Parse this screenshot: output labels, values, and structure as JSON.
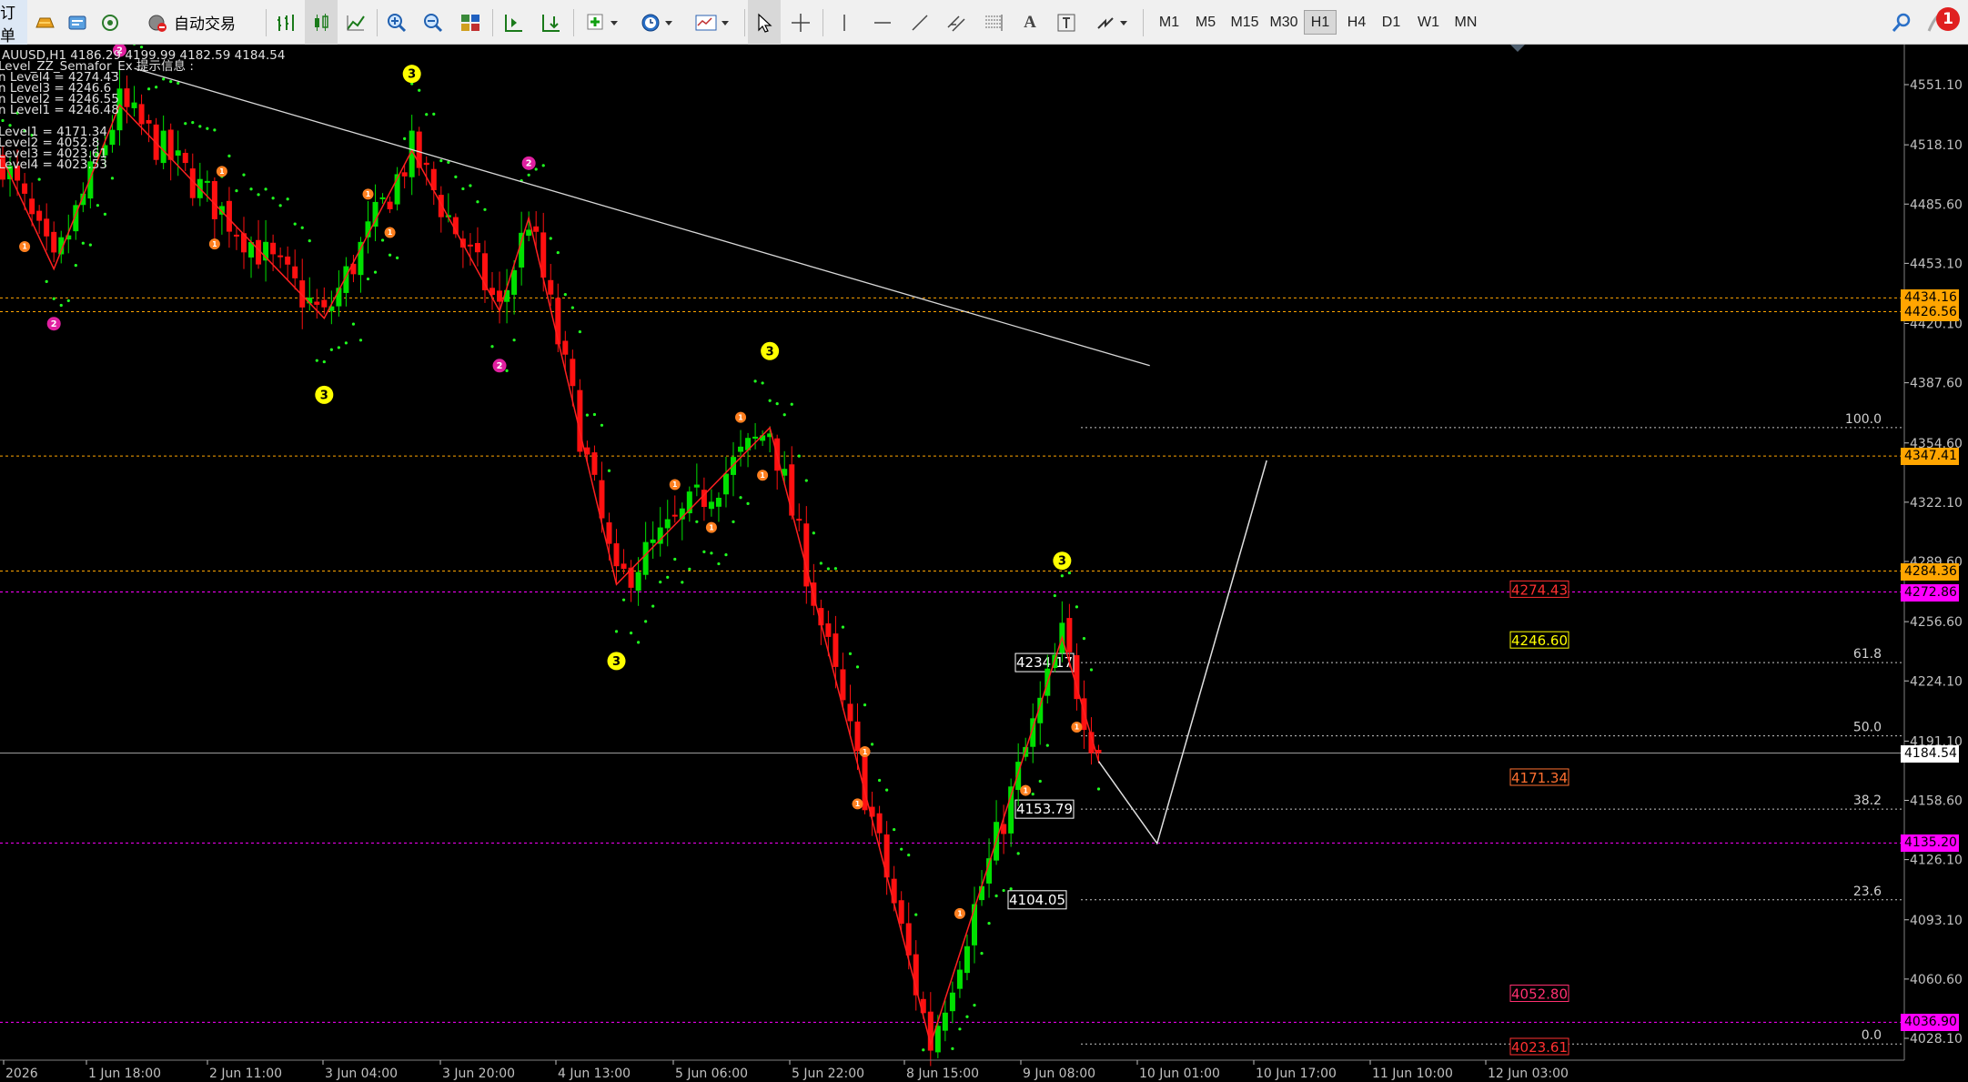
{
  "toolbar": {
    "orders_label": "订单",
    "autotrade_label": "自动交易",
    "timeframes": [
      "M1",
      "M5",
      "M15",
      "M30",
      "H1",
      "H4",
      "D1",
      "W1",
      "MN"
    ],
    "active_timeframe": "H1",
    "notification_count": "1"
  },
  "header": {
    "symbol_line": "AUUSD,H1  4186.29 4199.99 4182.59 4184.54",
    "indicator_name": "Level_ZZ_Semafor_Ex 提示信息 :",
    "level_lines": [
      "n Level4 = 4274.43",
      "n Level3 = 4246.6",
      "n Level2 = 4246.55",
      "n Level1 = 4246.48",
      "",
      "Level1 = 4171.34",
      "Level2 = 4052.8",
      "Level3 = 4023.61",
      "Level4 = 4023.53"
    ]
  },
  "colors": {
    "bull": "#00e000",
    "bear": "#ff1010",
    "zigzag": "#ff2020",
    "fib": "#c8c8c8",
    "orange_line": "#ffa500",
    "magenta_line": "#ff00ff",
    "semafor3": "#ffff00",
    "semafor2": "#e020a0",
    "semafor1": "#ff8020",
    "sar": "#20ff20"
  },
  "chart_data": {
    "type": "candlestick",
    "title": "AUUSD,H1",
    "ohlc_last": {
      "open": 4186.29,
      "high": 4199.99,
      "low": 4182.59,
      "close": 4184.54
    },
    "ylim": [
      4016,
      4566
    ],
    "y_ticks": [
      4551.1,
      4518.1,
      4485.6,
      4453.1,
      4420.1,
      4387.6,
      4354.6,
      4322.1,
      4289.6,
      4256.6,
      4224.1,
      4191.1,
      4158.6,
      4126.1,
      4093.1,
      4060.6,
      4028.1
    ],
    "x_labels": [
      "2026",
      "1 Jun 18:00",
      "2 Jun 11:00",
      "3 Jun 04:00",
      "3 Jun 20:00",
      "4 Jun 13:00",
      "5 Jun 06:00",
      "5 Jun 22:00",
      "8 Jun 15:00",
      "9 Jun 08:00",
      "10 Jun 01:00",
      "10 Jun 17:00",
      "11 Jun 10:00",
      "12 Jun 03:00"
    ],
    "zigzag": [
      [
        0,
        4510
      ],
      [
        7,
        4450
      ],
      [
        16,
        4540
      ],
      [
        44,
        4423
      ],
      [
        56,
        4515
      ],
      [
        68,
        4427
      ],
      [
        72,
        4478
      ],
      [
        84,
        4277
      ],
      [
        105,
        4363
      ],
      [
        127,
        4025
      ],
      [
        145,
        4248
      ],
      [
        150,
        4180
      ]
    ],
    "projection": [
      [
        150,
        4180
      ],
      [
        158,
        4135
      ],
      [
        173,
        4345
      ]
    ],
    "semafor": [
      {
        "bar": 7,
        "level": 2,
        "pos": "below"
      },
      {
        "bar": 16,
        "level": 2,
        "pos": "above"
      },
      {
        "bar": 44,
        "level": 3,
        "pos": "below"
      },
      {
        "bar": 56,
        "level": 3,
        "pos": "above"
      },
      {
        "bar": 68,
        "level": 2,
        "pos": "below"
      },
      {
        "bar": 72,
        "level": 2,
        "pos": "above"
      },
      {
        "bar": 84,
        "level": 3,
        "pos": "below"
      },
      {
        "bar": 105,
        "level": 3,
        "pos": "above"
      },
      {
        "bar": 145,
        "level": 3,
        "pos": "above"
      },
      {
        "bar": 3,
        "level": 1,
        "pos": "below"
      },
      {
        "bar": 30,
        "level": 1,
        "pos": "above"
      },
      {
        "bar": 29,
        "level": 1,
        "pos": "below"
      },
      {
        "bar": 50,
        "level": 1,
        "pos": "above"
      },
      {
        "bar": 53,
        "level": 1,
        "pos": "below"
      },
      {
        "bar": 92,
        "level": 1,
        "pos": "above"
      },
      {
        "bar": 97,
        "level": 1,
        "pos": "below"
      },
      {
        "bar": 104,
        "level": 1,
        "pos": "below"
      },
      {
        "bar": 101,
        "level": 1,
        "pos": "above"
      },
      {
        "bar": 118,
        "level": 1,
        "pos": "above"
      },
      {
        "bar": 117,
        "level": 1,
        "pos": "below"
      },
      {
        "bar": 131,
        "level": 1,
        "pos": "above"
      },
      {
        "bar": 140,
        "level": 1,
        "pos": "below"
      },
      {
        "bar": 147,
        "level": 1,
        "pos": "below"
      }
    ],
    "trendline": [
      [
        18,
        4560
      ],
      [
        157,
        4397
      ]
    ],
    "fibonacci": {
      "levels": [
        {
          "ratio": "100.0",
          "price": 4363
        },
        {
          "ratio": "61.8",
          "price": 4234.17
        },
        {
          "ratio": "50.0",
          "price": 4194
        },
        {
          "ratio": "38.2",
          "price": 4153.79
        },
        {
          "ratio": "23.6",
          "price": 4104.05
        },
        {
          "ratio": "0.0",
          "price": 4025
        }
      ],
      "price_tags": [
        "4234.17",
        "4153.79",
        "4104.05"
      ]
    },
    "horizontal_lines": [
      {
        "price": 4434.16,
        "color": "orange",
        "label": "4434.16"
      },
      {
        "price": 4426.56,
        "color": "orange",
        "label": "4426.56"
      },
      {
        "price": 4347.41,
        "color": "orange",
        "label": "4347.41"
      },
      {
        "price": 4284.36,
        "color": "orange",
        "label": "4284.36"
      },
      {
        "price": 4272.86,
        "color": "magenta",
        "label": "4272.86"
      },
      {
        "price": 4135.2,
        "color": "magenta",
        "label": "4135.20"
      },
      {
        "price": 4036.9,
        "color": "magenta",
        "label": "4036.90"
      },
      {
        "price": 4184.54,
        "color": "gray",
        "label": "4184.54"
      }
    ],
    "level_tags": [
      {
        "text": "4274.43",
        "price": 4274.43,
        "color": "#ff3030"
      },
      {
        "text": "4246.60",
        "price": 4246.6,
        "color": "#ffff00"
      },
      {
        "text": "4171.34",
        "price": 4171.34,
        "color": "#ff7030"
      },
      {
        "text": "4052.80",
        "price": 4052.8,
        "color": "#ff3070"
      },
      {
        "text": "4023.61",
        "price": 4023.61,
        "color": "#ff3030"
      }
    ]
  }
}
